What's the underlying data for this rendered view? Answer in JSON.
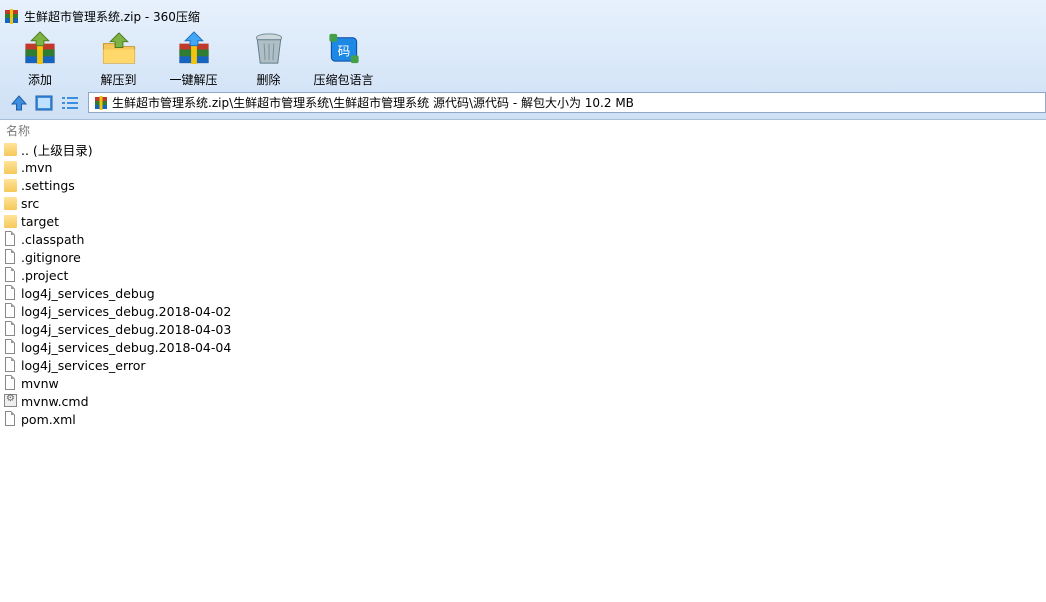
{
  "window": {
    "title": "生鲜超市管理系统.zip - 360压缩"
  },
  "toolbar": {
    "buttons": [
      {
        "label": "添加",
        "icon": "add-archive-icon"
      },
      {
        "label": "解压到",
        "icon": "extract-to-icon"
      },
      {
        "label": "一键解压",
        "icon": "one-click-extract-icon"
      },
      {
        "label": "删除",
        "icon": "delete-icon"
      },
      {
        "label": "压缩包语言",
        "icon": "archive-language-icon"
      }
    ]
  },
  "nav": {
    "path": "生鲜超市管理系统.zip\\生鲜超市管理系统\\生鲜超市管理系统 源代码\\源代码 - 解包大小为 10.2 MB"
  },
  "list": {
    "column_name": "名称",
    "items": [
      {
        "name": ".. (上级目录)",
        "type": "folder"
      },
      {
        "name": ".mvn",
        "type": "folder"
      },
      {
        "name": ".settings",
        "type": "folder"
      },
      {
        "name": "src",
        "type": "folder"
      },
      {
        "name": "target",
        "type": "folder"
      },
      {
        "name": ".classpath",
        "type": "file"
      },
      {
        "name": ".gitignore",
        "type": "file"
      },
      {
        "name": ".project",
        "type": "file"
      },
      {
        "name": "log4j_services_debug",
        "type": "file"
      },
      {
        "name": "log4j_services_debug.2018-04-02",
        "type": "file"
      },
      {
        "name": "log4j_services_debug.2018-04-03",
        "type": "file"
      },
      {
        "name": "log4j_services_debug.2018-04-04",
        "type": "file"
      },
      {
        "name": "log4j_services_error",
        "type": "file"
      },
      {
        "name": "mvnw",
        "type": "file"
      },
      {
        "name": "mvnw.cmd",
        "type": "cmd"
      },
      {
        "name": "pom.xml",
        "type": "file"
      }
    ]
  }
}
